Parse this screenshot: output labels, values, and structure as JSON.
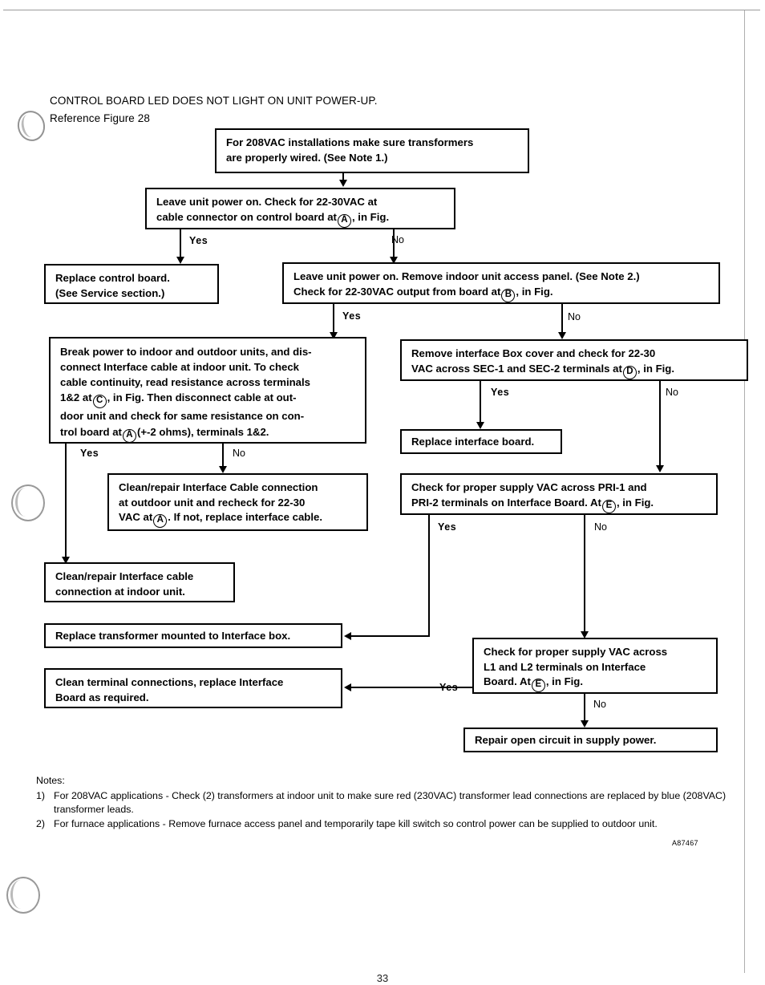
{
  "header": {
    "title": "CONTROL BOARD LED DOES NOT LIGHT ON UNIT POWER-UP.",
    "reference": "Reference Figure 28"
  },
  "flowchart": {
    "type": "diagram",
    "nodes": {
      "n1": {
        "line1": "For 208VAC installations make sure transformers",
        "line2": "are properly wired.  (See Note 1.)"
      },
      "n2": {
        "line1": "Leave unit power on.  Check for 22-30VAC at",
        "line2_a": "cable connector on control board at",
        "ref": "A",
        "line2_b": ", in Fig."
      },
      "n3": {
        "line1": "Replace control board.",
        "line2": "(See Service section.)"
      },
      "n4": {
        "line1": "Leave unit power on.  Remove indoor unit access panel.  (See Note 2.)",
        "line2_a": "Check for 22-30VAC output from board at",
        "ref": "B",
        "line2_b": ", in Fig."
      },
      "n5": {
        "line1": "Break power to indoor and outdoor units, and dis-",
        "line2": "connect Interface cable at indoor unit.  To check",
        "line3": "cable continuity, read resistance across terminals",
        "line4_a": "1&2 at",
        "ref1": "C",
        "line4_b": ", in Fig.  Then disconnect cable at out-",
        "line5": "door unit and check for same resistance on con-",
        "line6_a": "trol board at",
        "ref2": "A",
        "line6_b": "(+-2 ohms), terminals 1&2."
      },
      "n6": {
        "line1": "Remove interface Box cover and check for 22-30",
        "line2_a": "VAC across SEC-1 and SEC-2 terminals at",
        "ref": "D",
        "line2_b": ", in Fig."
      },
      "n7": {
        "line1": "Replace interface board."
      },
      "n8": {
        "line1": "Clean/repair Interface Cable connection",
        "line2": "at outdoor unit and recheck for 22-30",
        "line3_a": "VAC at",
        "ref": "A",
        "line3_b": ".  If not, replace interface cable."
      },
      "n9": {
        "line1": "Check for proper supply VAC across PRI-1 and",
        "line2_a": "PRI-2 terminals on Interface Board.  At",
        "ref": "E",
        "line2_b": ", in Fig."
      },
      "n10": {
        "line1": "Clean/repair Interface cable",
        "line2": "connection at indoor unit."
      },
      "n11": {
        "line1": "Replace transformer mounted to Interface box."
      },
      "n12": {
        "line1": "Clean terminal connections, replace Interface",
        "line2": "Board as required."
      },
      "n13": {
        "line1": "Check for proper supply VAC across",
        "line2": "L1 and L2 terminals on Interface",
        "line3_a": "Board.  At",
        "ref": "E",
        "line3_b": ", in Fig."
      },
      "n14": {
        "line1": "Repair open circuit in supply power."
      }
    },
    "labels": {
      "yes": "Yes",
      "no": "No"
    }
  },
  "notes": {
    "heading": "Notes:",
    "items": [
      {
        "num": "1)",
        "text": "For 208VAC applications - Check (2) transformers at indoor unit to make sure red (230VAC) transformer lead connections are replaced by blue (208VAC) transformer leads."
      },
      {
        "num": "2)",
        "text": "For furnace applications - Remove furnace access panel and temporarily tape kill switch so control power can be supplied to outdoor unit."
      }
    ]
  },
  "footer": {
    "doc_code": "A87467",
    "page_number": "33"
  }
}
